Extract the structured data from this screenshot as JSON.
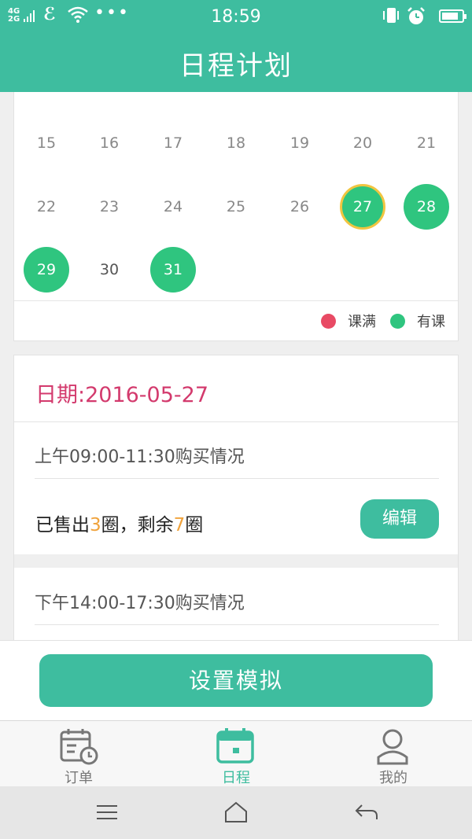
{
  "status_bar": {
    "network_label": "4G\n2G",
    "time": "18:59",
    "icons": [
      "signal-icon",
      "carrier-icon",
      "wifi-icon",
      "more-icon",
      "vibrate-icon",
      "alarm-icon",
      "battery-icon"
    ]
  },
  "header": {
    "title": "日程计划"
  },
  "calendar": {
    "rows": [
      [
        {
          "d": "15"
        },
        {
          "d": "16"
        },
        {
          "d": "17"
        },
        {
          "d": "18"
        },
        {
          "d": "19"
        },
        {
          "d": "20"
        },
        {
          "d": "21"
        }
      ],
      [
        {
          "d": "22"
        },
        {
          "d": "23"
        },
        {
          "d": "24"
        },
        {
          "d": "25"
        },
        {
          "d": "26"
        },
        {
          "d": "27",
          "status": "has",
          "selected": true
        },
        {
          "d": "28",
          "status": "has"
        }
      ],
      [
        {
          "d": "29",
          "status": "has"
        },
        {
          "d": "30"
        },
        {
          "d": "31",
          "status": "has"
        }
      ]
    ],
    "legend": [
      {
        "label": "课满",
        "color": "#e84a64"
      },
      {
        "label": "有课",
        "color": "#2fc57f"
      }
    ]
  },
  "schedule": {
    "date_label": "日期:2016-05-27",
    "sessions": [
      {
        "title": "上午09:00-11:30购买情况",
        "sold_prefix": "已售出",
        "sold_count": "3",
        "sold_mid": "圈，剩余",
        "remaining_count": "7",
        "sold_suffix": "圈",
        "edit_label": "编辑"
      },
      {
        "title": "下午14:00-17:30购买情况"
      }
    ]
  },
  "actions": {
    "simulate_label": "设置模拟"
  },
  "tabs": [
    {
      "label": "订单",
      "icon": "order-calendar-icon",
      "active": false
    },
    {
      "label": "日程",
      "icon": "schedule-calendar-icon",
      "active": true
    },
    {
      "label": "我的",
      "icon": "profile-icon",
      "active": false
    }
  ],
  "nav": [
    "menu-icon",
    "home-icon",
    "back-icon"
  ],
  "colors": {
    "primary": "#3ebd9f",
    "has_class": "#2fc57f",
    "full_class": "#e84a64",
    "date_text": "#d33a6d",
    "count_text": "#f0a33c",
    "selected_ring": "#f1c540"
  }
}
